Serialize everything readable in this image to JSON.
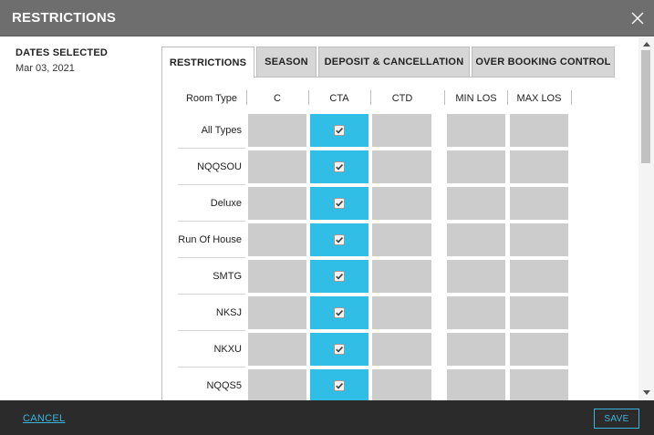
{
  "dialog": {
    "title": "RESTRICTIONS"
  },
  "dates": {
    "label": "DATES SELECTED",
    "value": "Mar 03, 2021"
  },
  "tabs": [
    {
      "label": "RESTRICTIONS",
      "active": true
    },
    {
      "label": "SEASON",
      "active": false
    },
    {
      "label": "DEPOSIT & CANCELLATION",
      "active": false
    },
    {
      "label": "OVER BOOKING CONTROL",
      "active": false
    }
  ],
  "grid": {
    "headers": {
      "room_type": "Room Type",
      "c": "C",
      "cta": "CTA",
      "ctd": "CTD",
      "min_los": "MIN LOS",
      "max_los": "MAX LOS"
    },
    "rows": [
      {
        "room_type": "All Types",
        "cta_checked": true
      },
      {
        "room_type": "NQQSOU",
        "cta_checked": true
      },
      {
        "room_type": "Deluxe",
        "cta_checked": true
      },
      {
        "room_type": "Run Of House",
        "cta_checked": true
      },
      {
        "room_type": "SMTG",
        "cta_checked": true
      },
      {
        "room_type": "NKSJ",
        "cta_checked": true
      },
      {
        "room_type": "NKXU",
        "cta_checked": true
      },
      {
        "room_type": "NQQS5",
        "cta_checked": true
      }
    ]
  },
  "footer": {
    "cancel_label": "CANCEL",
    "save_label": "SAVE"
  },
  "colors": {
    "titlebar": "#6e6e6e",
    "cta_active": "#31bee6",
    "cell_inactive": "#cccccc",
    "footer": "#2b2b2b",
    "link_accent": "#3ab4dc"
  }
}
